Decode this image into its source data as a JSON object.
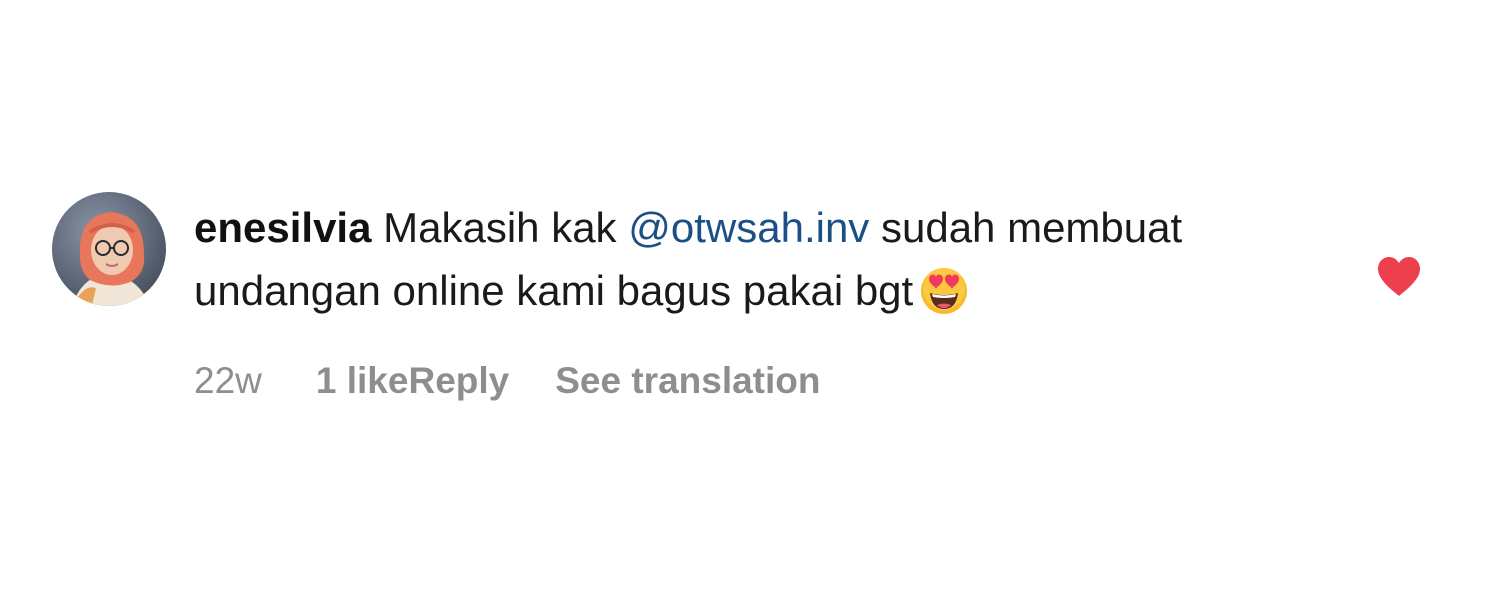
{
  "comment": {
    "username": "enesilvia",
    "text_before_mention": " Makasih kak ",
    "mention": "@otwsah.inv",
    "text_after_mention": " sudah membuat undangan online kami bagus pakai bgt",
    "emoji": "smiling-face-with-heart-eyes-icon",
    "time": "22w",
    "likes": "1 like",
    "reply": "Reply",
    "translate": "See translation",
    "liked": true
  },
  "colors": {
    "mention": "#1c4f86",
    "meta": "#8e8e8e",
    "heart": "#ed3f4e",
    "hijab": "#e8765a"
  }
}
